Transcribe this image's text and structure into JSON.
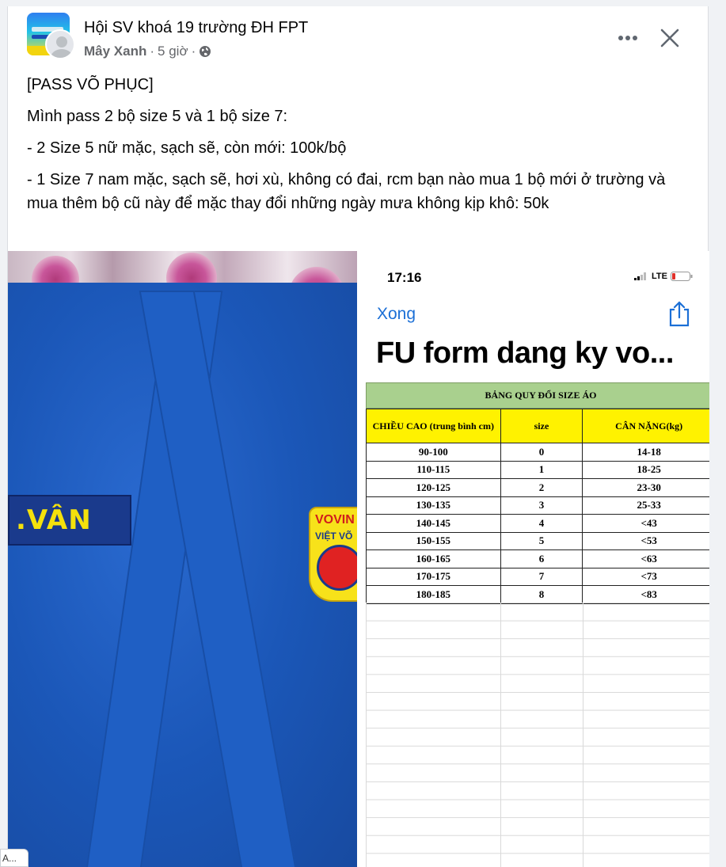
{
  "post": {
    "group_name": "Hội SV khoá 19 trường ĐH FPT",
    "author": "Mây Xanh",
    "time": "5 giờ",
    "separator": "·",
    "privacy_icon": "globe-icon",
    "paragraphs": [
      "[PASS VÕ PHỤC]",
      "Mình pass 2 bộ size 5 và 1 bộ size 7:",
      "- 2 Size 5 nữ mặc, sạch sẽ, còn mới: 100k/bộ",
      "- 1 Size 7 nam mặc, sạch sẽ, hơi xù, không có đai, rcm bạn nào mua 1 bộ mới ở trường và mua thêm bộ cũ này để mặc thay đổi những ngày mưa không kịp khô: 50k"
    ]
  },
  "photo_left": {
    "name_patch": "VÂN",
    "name_patch_prefix": ".",
    "badge_top": "VOVIN",
    "badge_mid": "VIỆT VÕ"
  },
  "phone": {
    "time": "17:16",
    "network": "LTE",
    "done_label": "Xong",
    "title": "FU form dang ky vo...",
    "sheet_title": "BẢNG QUY ĐỔI SIZE ÁO",
    "headers": [
      "CHIỀU CAO (trung bình cm)",
      "size",
      "CÂN NẶNG(kg)"
    ],
    "rows": [
      [
        "90-100",
        "0",
        "14-18"
      ],
      [
        "110-115",
        "1",
        "18-25"
      ],
      [
        "120-125",
        "2",
        "23-30"
      ],
      [
        "130-135",
        "3",
        "25-33"
      ],
      [
        "140-145",
        "4",
        "<43"
      ],
      [
        "150-155",
        "5",
        "<53"
      ],
      [
        "160-165",
        "6",
        "<63"
      ],
      [
        "170-175",
        "7",
        "<73"
      ],
      [
        "180-185",
        "8",
        "<83"
      ]
    ]
  },
  "tooltip": "A..."
}
